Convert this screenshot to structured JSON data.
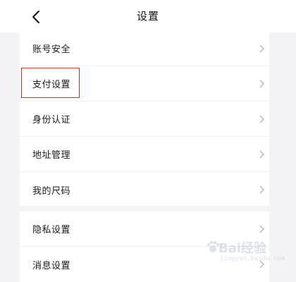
{
  "header": {
    "title": "设置"
  },
  "groups": [
    {
      "items": [
        {
          "label": "账号安全"
        },
        {
          "label": "支付设置"
        },
        {
          "label": "身份认证"
        },
        {
          "label": "地址管理"
        },
        {
          "label": "我的尺码"
        }
      ]
    },
    {
      "items": [
        {
          "label": "隐私设置"
        },
        {
          "label": "消息设置"
        }
      ]
    }
  ],
  "highlight_target": "支付设置",
  "watermark": {
    "text": "Bai经验",
    "sub": "jingyan.baidu.com"
  },
  "colors": {
    "background": "#f4f4f6",
    "card": "#ffffff",
    "highlight_border": "#d9262a",
    "chevron": "#b5b5b5"
  }
}
